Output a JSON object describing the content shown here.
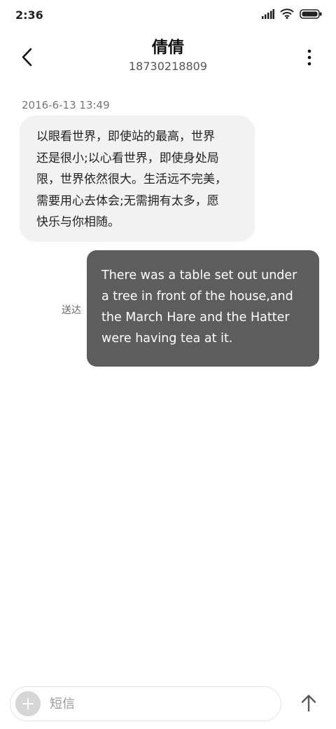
{
  "status_bar": {
    "time": "2:36",
    "icons": [
      "signal-icon",
      "wifi-icon",
      "battery-icon"
    ]
  },
  "header": {
    "contact_name": "倩倩",
    "contact_number": "18730218809",
    "back_icon": "chevron-left-icon",
    "more_icon": "more-vertical-icon"
  },
  "conversation": {
    "timestamp": "2016-6-13 13:49",
    "messages": [
      {
        "direction": "incoming",
        "text": "以眼看世界，即使站的最高，世界\n还是很小;以心看世界，即使身处局\n限，世界依然很大。生活远不完美，\n需要用心去体会;无需拥有太多，愿\n快乐与你相随。"
      },
      {
        "direction": "outgoing",
        "status": "送达",
        "text": "There was a table set out under\na tree in front of the house,and\nthe March Hare and the Hatter\nwere having tea at it."
      }
    ]
  },
  "composer": {
    "placeholder": "短信",
    "value": "",
    "add_icon": "plus-icon",
    "send_icon": "arrow-up-icon"
  },
  "colors": {
    "incoming_bubble": "#f2f2f2",
    "outgoing_bubble": "#5d5d5d",
    "background": "#ffffff"
  }
}
